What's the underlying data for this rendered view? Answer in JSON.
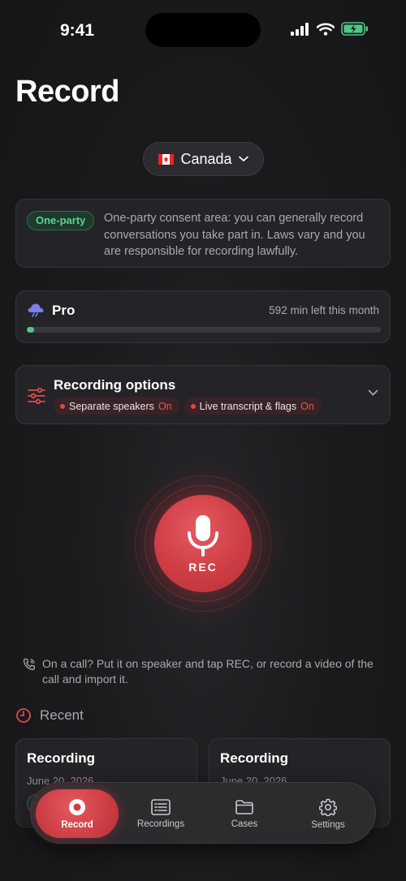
{
  "status_bar": {
    "time": "9:41"
  },
  "page": {
    "title": "Record"
  },
  "country_selector": {
    "label": "Canada"
  },
  "consent": {
    "badge": "One-party",
    "text": "One-party consent area: you can generally record conversations you take part in. Laws vary and you are responsible for recording lawfully."
  },
  "plan": {
    "name": "Pro",
    "remaining": "592 min left this month",
    "usage_fraction": 0.02
  },
  "options": {
    "title": "Recording options",
    "chips": [
      {
        "label": "Separate speakers",
        "state": "On"
      },
      {
        "label": "Live transcript & flags",
        "state": "On"
      }
    ]
  },
  "rec_button": {
    "label": "REC"
  },
  "call_hint": {
    "text": "On a call? Put it on speaker and tap REC, or record a video of the call and import it."
  },
  "recent": {
    "title": "Recent",
    "items": [
      {
        "title": "Recording",
        "date": "June 20, 2026"
      },
      {
        "title": "Recording",
        "date": "June 20, 2026"
      }
    ]
  },
  "tabs": [
    {
      "label": "Record",
      "icon": "record-icon",
      "active": true
    },
    {
      "label": "Recordings",
      "icon": "list-icon",
      "active": false
    },
    {
      "label": "Cases",
      "icon": "folder-icon",
      "active": false
    },
    {
      "label": "Settings",
      "icon": "gear-icon",
      "active": false
    }
  ],
  "colors": {
    "accent": "#cf3d45",
    "success": "#4fc684",
    "background": "#1b1b1e"
  }
}
